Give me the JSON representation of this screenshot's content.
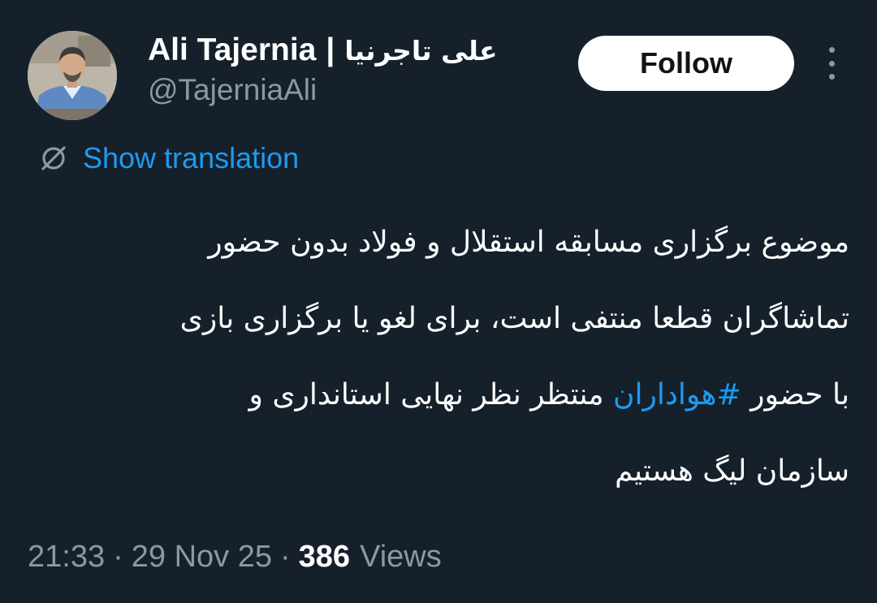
{
  "author": {
    "name_en": "Ali Tajernia",
    "name_sep": "|",
    "name_fa": "علی تاجرنیا",
    "handle": "@TajerniaAli"
  },
  "actions": {
    "follow_label": "Follow",
    "more_icon": "more-vertical-icon"
  },
  "translation": {
    "label": "Show translation",
    "icon": "translate-icon"
  },
  "tweet": {
    "line1": "موضوع برگزاری مسابقه استقلال و فولاد بدون حضور",
    "line2": "تماشاگران قطعا منتفی است، برای لغو یا برگزاری بازی",
    "line3_before": "با حضور",
    "hashtag": "#هواداران",
    "line3_after": "منتظر نظر نهایی استانداری و",
    "line4": "سازمان لیگ هستیم"
  },
  "meta": {
    "time": "21:33",
    "date": "29 Nov 25",
    "separator": "·",
    "views_count": "386",
    "views_label": "Views"
  },
  "colors": {
    "background": "#15202b",
    "accent": "#1d9bf0",
    "secondary_text": "#8b98a5"
  }
}
